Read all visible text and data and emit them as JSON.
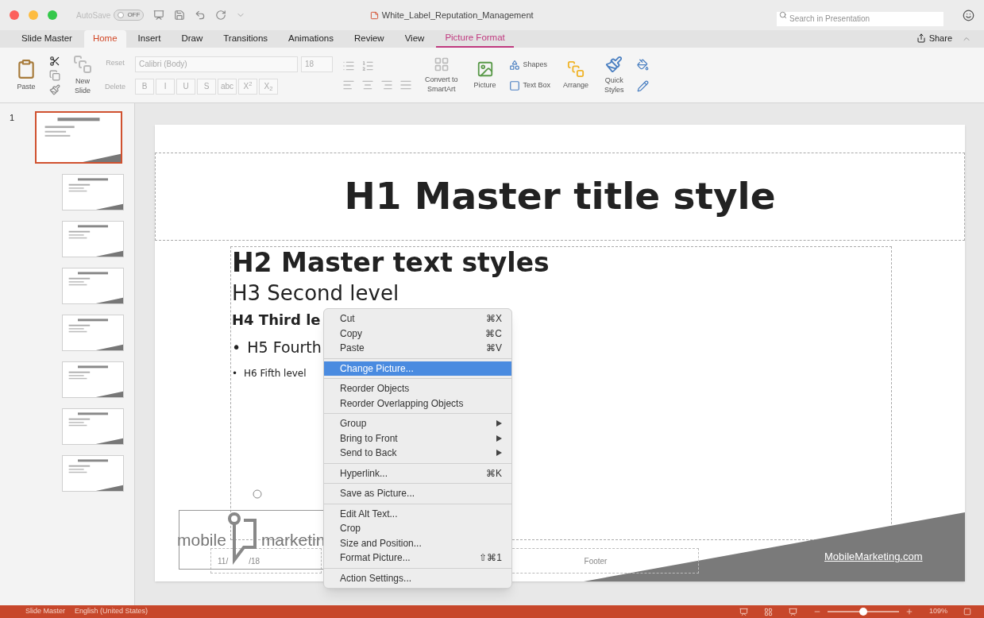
{
  "window": {
    "title": "White_Label_Reputation_Management",
    "autosave": {
      "label": "AutoSave",
      "state": "OFF",
      "on": false
    },
    "search": {
      "placeholder": "Search in Presentation"
    }
  },
  "tabs": [
    {
      "label": "Slide Master",
      "selected": false,
      "kind": "normal"
    },
    {
      "label": "Home",
      "selected": true,
      "kind": "normal"
    },
    {
      "label": "Insert",
      "selected": false,
      "kind": "normal"
    },
    {
      "label": "Draw",
      "selected": false,
      "kind": "normal"
    },
    {
      "label": "Transitions",
      "selected": false,
      "kind": "normal"
    },
    {
      "label": "Animations",
      "selected": false,
      "kind": "normal"
    },
    {
      "label": "Review",
      "selected": false,
      "kind": "normal"
    },
    {
      "label": "View",
      "selected": false,
      "kind": "normal"
    },
    {
      "label": "Picture Format",
      "selected": false,
      "kind": "contextual"
    }
  ],
  "share": "Share",
  "ribbon": {
    "paste": "Paste",
    "new_slide": "New\nSlide",
    "reset": "Reset",
    "delete": "Delete",
    "font": "Calibri (Body)",
    "size": "18",
    "format_buttons": [
      "B",
      "I",
      "U",
      "S",
      "abc",
      "X$^{2}$",
      "X$_{2}$"
    ],
    "convert": "Convert to\nSmartArt",
    "picture": "Picture",
    "shapes": "Shapes",
    "text_box": "Text Box",
    "arrange": "Arrange",
    "quick_styles": "Quick\nStyles"
  },
  "thumbnails": [
    {
      "number": "1",
      "kind": "master",
      "selected": true
    },
    {
      "kind": "layout",
      "selected": false
    },
    {
      "kind": "layout",
      "selected": false
    },
    {
      "kind": "layout",
      "selected": false
    },
    {
      "kind": "layout",
      "selected": false
    },
    {
      "kind": "layout",
      "selected": false
    },
    {
      "kind": "layout",
      "selected": false
    },
    {
      "kind": "layout",
      "selected": false
    }
  ],
  "slide": {
    "title": "H1 Master title style",
    "body": [
      {
        "text": "H2 Master text styles"
      },
      {
        "text": "H3 Second level"
      },
      {
        "text": "H4 Third le"
      },
      {
        "text": "H5 Fourth",
        "bullet": "•"
      },
      {
        "text": "H6 Fifth level",
        "bullet": "•"
      }
    ],
    "logo": [
      "mobile",
      "marketin"
    ],
    "date": [
      "11/",
      "/18"
    ],
    "footer": "Footer",
    "link": "MobileMarketing.com"
  },
  "context_menu": [
    [
      {
        "label": "Cut",
        "shortcut": "⌘X",
        "selected": false,
        "submenu": false
      },
      {
        "label": "Copy",
        "shortcut": "⌘C",
        "selected": false,
        "submenu": false
      },
      {
        "label": "Paste",
        "shortcut": "⌘V",
        "selected": false,
        "submenu": false
      }
    ],
    [
      {
        "label": "Change Picture...",
        "selected": true,
        "submenu": false
      }
    ],
    [
      {
        "label": "Reorder Objects",
        "selected": false,
        "submenu": false
      },
      {
        "label": "Reorder Overlapping Objects",
        "selected": false,
        "submenu": false
      }
    ],
    [
      {
        "label": "Group",
        "selected": false,
        "submenu": true
      },
      {
        "label": "Bring to Front",
        "selected": false,
        "submenu": true
      },
      {
        "label": "Send to Back",
        "selected": false,
        "submenu": true
      }
    ],
    [
      {
        "label": "Hyperlink...",
        "shortcut": "⌘K",
        "selected": false,
        "submenu": false
      }
    ],
    [
      {
        "label": "Save as Picture...",
        "selected": false,
        "submenu": false
      }
    ],
    [
      {
        "label": "Edit Alt Text...",
        "selected": false,
        "submenu": false
      },
      {
        "label": "Crop",
        "selected": false,
        "submenu": false
      },
      {
        "label": "Size and Position...",
        "selected": false,
        "submenu": false
      },
      {
        "label": "Format Picture...",
        "shortcut": "⇧⌘1",
        "selected": false,
        "submenu": false
      }
    ],
    [
      {
        "label": "Action Settings...",
        "selected": false,
        "submenu": false
      }
    ]
  ],
  "status_bar": {
    "view": "Slide Master",
    "language": "English (United States)",
    "zoom": {
      "level": 0.5,
      "reading": "109%"
    }
  }
}
